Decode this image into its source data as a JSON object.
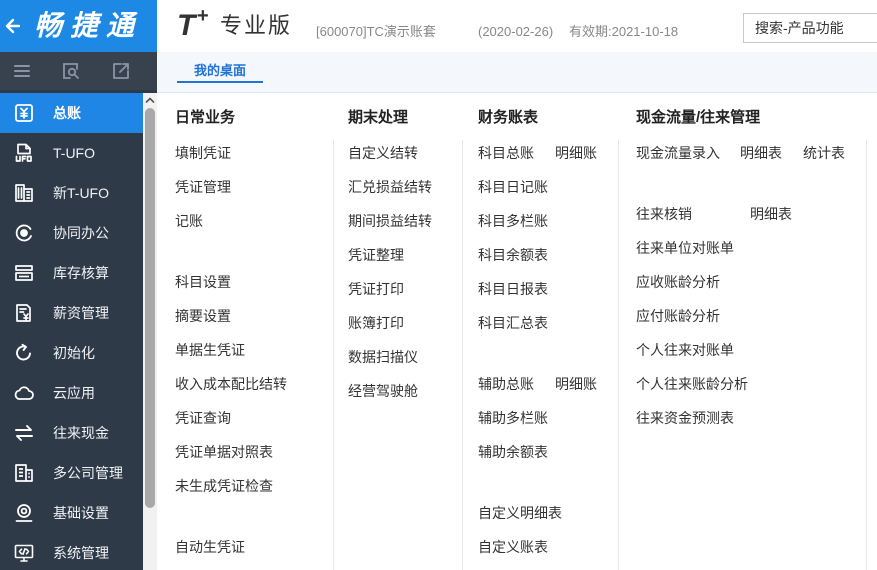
{
  "colors": {
    "brand_blue": "#1e88e5",
    "sidebar_bg": "#2f3a48",
    "active_item_bg": "#1f86e5",
    "tab_active": "#2173d6"
  },
  "sidebar": {
    "logo_text": "畅捷通",
    "back_icon": "back-arrow-icon",
    "toolbar_icons": [
      "menu-icon",
      "search-document-icon",
      "export-document-icon"
    ],
    "items": [
      {
        "label": "总账",
        "icon": "ledger-icon",
        "active": true
      },
      {
        "label": "T-UFO",
        "icon": "ufo-report-icon"
      },
      {
        "label": "新T-UFO",
        "icon": "new-ufo-report-icon"
      },
      {
        "label": "协同办公",
        "icon": "collaboration-icon"
      },
      {
        "label": "库存核算",
        "icon": "inventory-icon"
      },
      {
        "label": "薪资管理",
        "icon": "payroll-icon"
      },
      {
        "label": "初始化",
        "icon": "refresh-icon"
      },
      {
        "label": "云应用",
        "icon": "cloud-icon"
      },
      {
        "label": "往来现金",
        "icon": "exchange-icon"
      },
      {
        "label": "多公司管理",
        "icon": "building-icon"
      },
      {
        "label": "基础设置",
        "icon": "settings-icon"
      },
      {
        "label": "系统管理",
        "icon": "monitor-code-icon"
      }
    ]
  },
  "header": {
    "logo_letter": "T",
    "logo_plus": "+",
    "edition": "专业版",
    "account": "[600070]TC演示账套",
    "date": "(2020-02-26)",
    "validity": "有效期:2021-10-18",
    "search_placeholder": "搜索-产品功能"
  },
  "tabs": [
    {
      "label": "我的桌面",
      "active": true
    }
  ],
  "desktop": {
    "columns": [
      {
        "title": "日常业务",
        "groups": [
          [
            {
              "label": "填制凭证"
            },
            {
              "label": "凭证管理"
            },
            {
              "label": "记账"
            }
          ],
          [
            {
              "label": "科目设置"
            },
            {
              "label": "摘要设置"
            },
            {
              "label": "单据生凭证"
            },
            {
              "label": "收入成本配比结转"
            },
            {
              "label": "凭证查询"
            },
            {
              "label": "凭证单据对照表"
            },
            {
              "label": "未生成凭证检查"
            }
          ],
          [
            {
              "label": "自动生凭证"
            }
          ]
        ]
      },
      {
        "title": "期末处理",
        "groups": [
          [
            {
              "label": "自定义结转"
            },
            {
              "label": "汇兑损益结转"
            },
            {
              "label": "期间损益结转"
            },
            {
              "label": "凭证整理"
            },
            {
              "label": "凭证打印"
            },
            {
              "label": "账簿打印"
            },
            {
              "label": "数据扫描仪"
            },
            {
              "label": "经营驾驶舱"
            }
          ]
        ]
      },
      {
        "title": "财务账表",
        "groups": [
          [
            {
              "label": "科目总账",
              "links": [
                "明细账"
              ]
            },
            {
              "label": "科目日记账"
            },
            {
              "label": "科目多栏账"
            },
            {
              "label": "科目余额表"
            },
            {
              "label": "科目日报表"
            },
            {
              "label": "科目汇总表"
            }
          ],
          [
            {
              "label": "辅助总账",
              "links": [
                "明细账"
              ]
            },
            {
              "label": "辅助多栏账"
            },
            {
              "label": "辅助余额表"
            }
          ],
          [
            {
              "label": "自定义明细表"
            },
            {
              "label": "自定义账表"
            }
          ]
        ]
      },
      {
        "title": "现金流量/往来管理",
        "groups": [
          [
            {
              "label": "现金流量录入",
              "links": [
                "明细表",
                "统计表"
              ]
            }
          ],
          [
            {
              "label": "往来核销",
              "links": [
                "明细表"
              ]
            },
            {
              "label": "往来单位对账单"
            },
            {
              "label": "应收账龄分析"
            },
            {
              "label": "应付账龄分析"
            },
            {
              "label": "个人往来对账单"
            },
            {
              "label": "个人往来账龄分析"
            },
            {
              "label": "往来资金预测表"
            }
          ]
        ]
      }
    ]
  }
}
